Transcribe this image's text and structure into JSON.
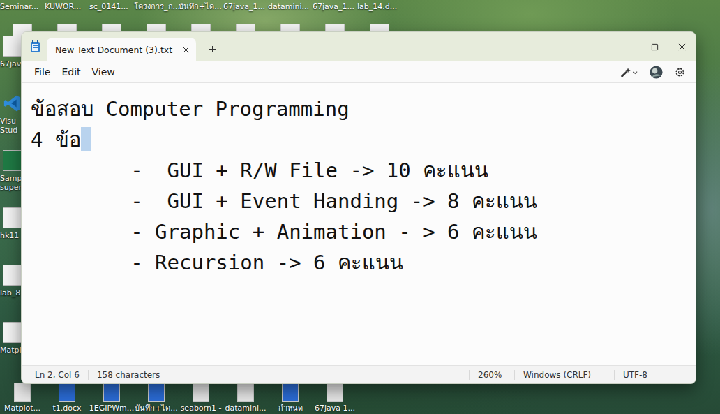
{
  "desktop": {
    "top_icons": [
      {
        "label": "Seminar...",
        "kind": "doc"
      },
      {
        "label": "KUWOR...",
        "kind": "doc"
      },
      {
        "label": "sc_0141...",
        "kind": "doc"
      },
      {
        "label": "โครงการ_ก...",
        "kind": "doc"
      },
      {
        "label": "บันทึก+ได...",
        "kind": "doc"
      },
      {
        "label": "67java_1...",
        "kind": "doc"
      },
      {
        "label": "datamini...",
        "kind": "doc"
      },
      {
        "label": "67java_1...",
        "kind": "doc"
      },
      {
        "label": "lab_14.d...",
        "kind": "doc"
      }
    ],
    "left_icons": [
      {
        "label": "67java",
        "kind": "doc"
      },
      {
        "label": "Visu Stud",
        "kind": "vscode"
      },
      {
        "label": "Samp super",
        "kind": "excel"
      },
      {
        "label": "hk11",
        "kind": "doc"
      },
      {
        "label": "lab_8",
        "kind": "doc"
      },
      {
        "label": "Matpl",
        "kind": "doc"
      }
    ],
    "bottom_icons": [
      {
        "label": "Matplot...",
        "kind": "pptx"
      },
      {
        "label": "t1.docx",
        "kind": "word"
      },
      {
        "label": "1EGIPWm...",
        "kind": "word"
      },
      {
        "label": "บันทึก+ได...",
        "kind": "word"
      },
      {
        "label": "seaborn1 -",
        "kind": "pptx"
      },
      {
        "label": "datamini...",
        "kind": "pptx"
      },
      {
        "label": "กำหนด",
        "kind": "word"
      },
      {
        "label": "67java 1...",
        "kind": "pptx"
      }
    ]
  },
  "window": {
    "tab_title": "New Text Document (3).txt"
  },
  "menu": [
    {
      "label": "File"
    },
    {
      "label": "Edit"
    },
    {
      "label": "View"
    }
  ],
  "editor": {
    "lines": [
      {
        "text": "ข้อสอบ Computer Programming",
        "indented": false,
        "has_selection": false
      },
      {
        "text": "4 ข้อ",
        "indented": false,
        "has_selection": true
      },
      {
        "text": "-  GUI + R/W File -> 10 คะแนน",
        "indented": true,
        "has_selection": false
      },
      {
        "text": "-  GUI + Event Handing -> 8 คะแนน",
        "indented": true,
        "has_selection": false
      },
      {
        "text": "- Graphic + Animation - > 6 คะแนน",
        "indented": true,
        "has_selection": false
      },
      {
        "text": "- Recursion -> 6 คะแนน",
        "indented": true,
        "has_selection": false
      }
    ]
  },
  "status_bar": {
    "position": "Ln 2, Col 6",
    "characters": "158 characters",
    "zoom": "260%",
    "line_ending": "Windows (CRLF)",
    "encoding": "UTF-8"
  }
}
